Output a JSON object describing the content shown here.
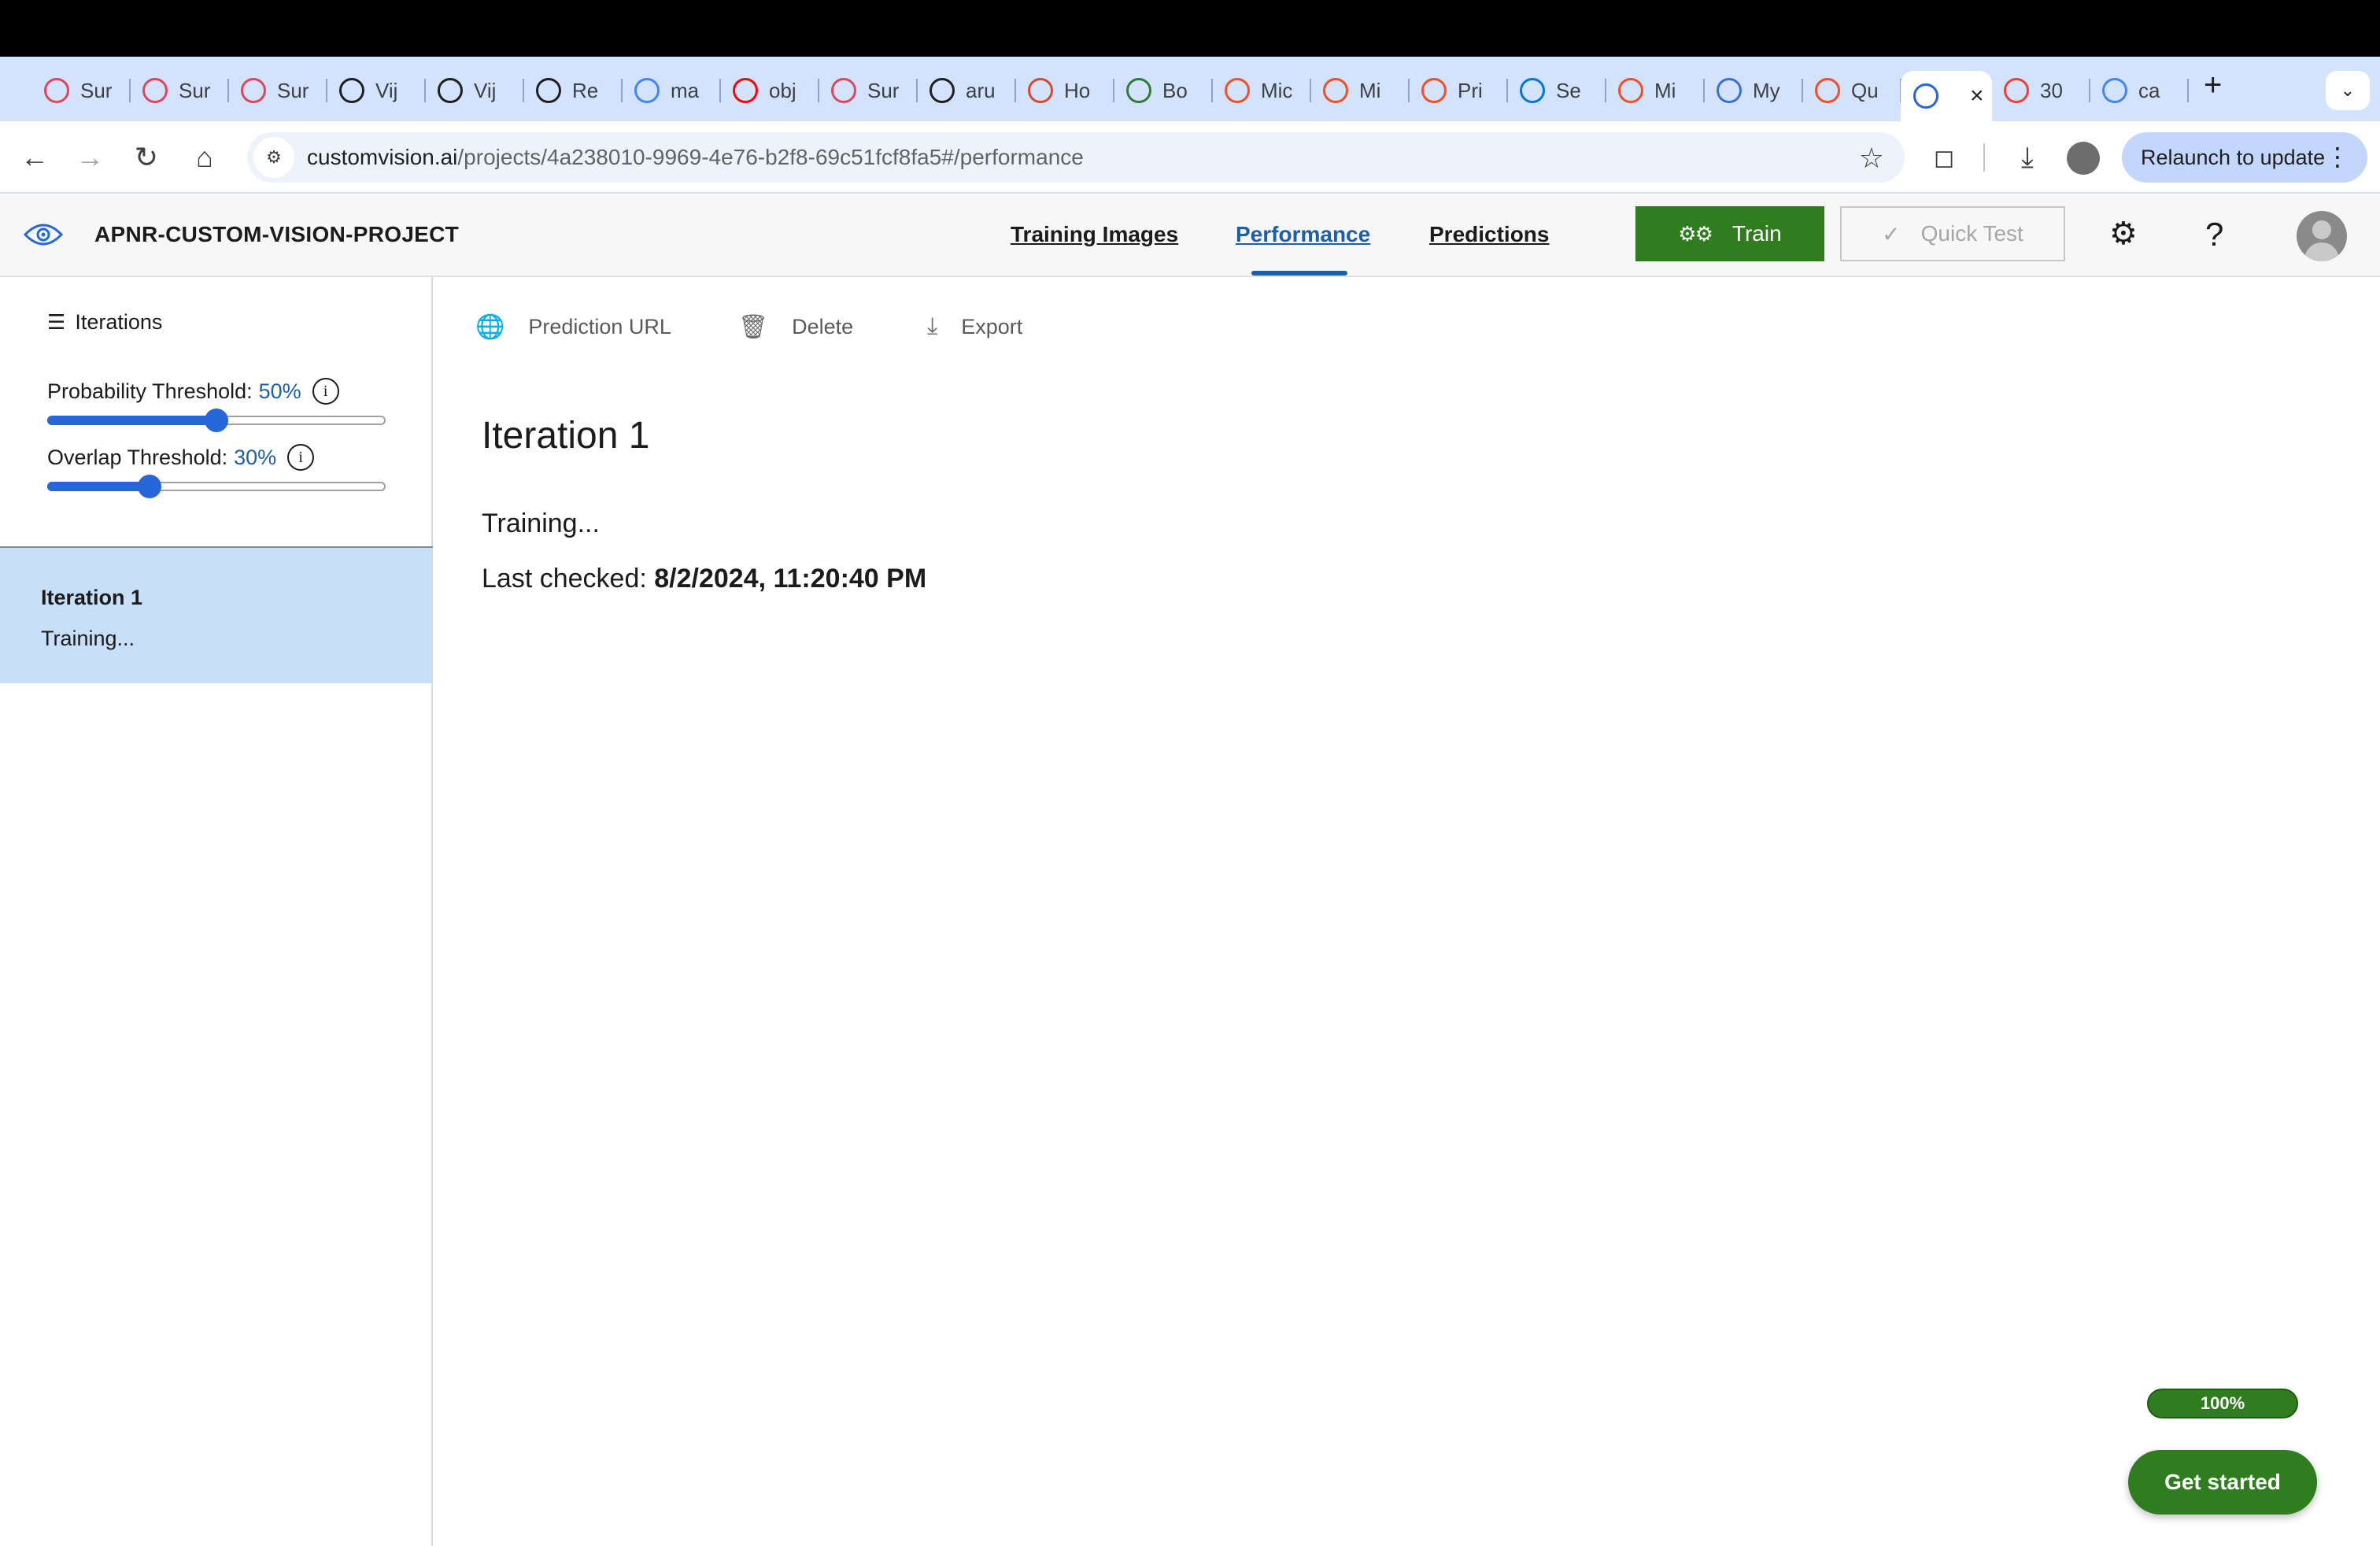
{
  "browser": {
    "tabs": [
      {
        "title": "Sur",
        "favicon": "swirl-icon",
        "color": "#e0455a"
      },
      {
        "title": "Sur",
        "favicon": "swirl-icon",
        "color": "#e0455a"
      },
      {
        "title": "Sur",
        "favicon": "swirl-icon",
        "color": "#e0455a"
      },
      {
        "title": "Vij",
        "favicon": "github-icon",
        "color": "#1f1f1f"
      },
      {
        "title": "Vij",
        "favicon": "github-icon",
        "color": "#1f1f1f"
      },
      {
        "title": "Re",
        "favicon": "react-icon",
        "color": "#1f1f1f"
      },
      {
        "title": "ma",
        "favicon": "google-icon",
        "color": "#4285f4"
      },
      {
        "title": "obj",
        "favicon": "youtube-icon",
        "color": "#ff0000"
      },
      {
        "title": "Sur",
        "favicon": "swirl-icon",
        "color": "#e0455a"
      },
      {
        "title": "aru",
        "favicon": "github-icon",
        "color": "#1f1f1f"
      },
      {
        "title": "Ho",
        "favicon": "globe-icon",
        "color": "#d24b2f"
      },
      {
        "title": "Bo",
        "favicon": "book-icon",
        "color": "#2e7d32"
      },
      {
        "title": "Mic",
        "favicon": "microsoft-icon",
        "color": "#f25022"
      },
      {
        "title": "Mi",
        "favicon": "microsoft-icon",
        "color": "#f25022"
      },
      {
        "title": "Pri",
        "favicon": "microsoft-icon",
        "color": "#f25022"
      },
      {
        "title": "Se",
        "favicon": "azure-icon",
        "color": "#0078d4"
      },
      {
        "title": "Mi",
        "favicon": "microsoft-icon",
        "color": "#f25022"
      },
      {
        "title": "My",
        "favicon": "check-icon",
        "color": "#3b6fd6"
      },
      {
        "title": "Qu",
        "favicon": "microsoft-icon",
        "color": "#f25022"
      },
      {
        "title": "",
        "favicon": "custom-vision-icon",
        "color": "#2566d8",
        "active": true
      },
      {
        "title": "30",
        "favicon": "gmail-icon",
        "color": "#ea4335"
      },
      {
        "title": "ca",
        "favicon": "google-icon",
        "color": "#4285f4"
      }
    ],
    "url_host": "customvision.ai",
    "url_path": "/projects/4a238010-9969-4e76-b2f8-69c51fcf8fa5#/performance",
    "relaunch_label": "Relaunch to update"
  },
  "header": {
    "project_name": "APNR-CUSTOM-VISION-PROJECT",
    "nav": {
      "training_images": "Training Images",
      "performance": "Performance",
      "predictions": "Predictions"
    },
    "train_label": "Train",
    "quick_test_label": "Quick Test"
  },
  "sidebar": {
    "title": "Iterations",
    "probability_threshold": {
      "label": "Probability Threshold:",
      "value": "50%",
      "fraction": 0.5
    },
    "overlap_threshold": {
      "label": "Overlap Threshold:",
      "value": "30%",
      "fraction": 0.3
    },
    "iteration": {
      "name": "Iteration 1",
      "status": "Training..."
    }
  },
  "main": {
    "commands": {
      "prediction_url": "Prediction URL",
      "delete": "Delete",
      "export": "Export"
    },
    "iteration_title": "Iteration 1",
    "status": "Training...",
    "last_checked_label": "Last checked:",
    "last_checked_value": "8/2/2024, 11:20:40 PM"
  },
  "widget": {
    "progress": "100%",
    "progress_fraction": 1.0,
    "get_started": "Get started"
  },
  "colors": {
    "accent": "#1b5fa8",
    "train_green": "#2f7d1f",
    "selected_row": "#c7e0f8",
    "slider_blue": "#2566d8"
  }
}
